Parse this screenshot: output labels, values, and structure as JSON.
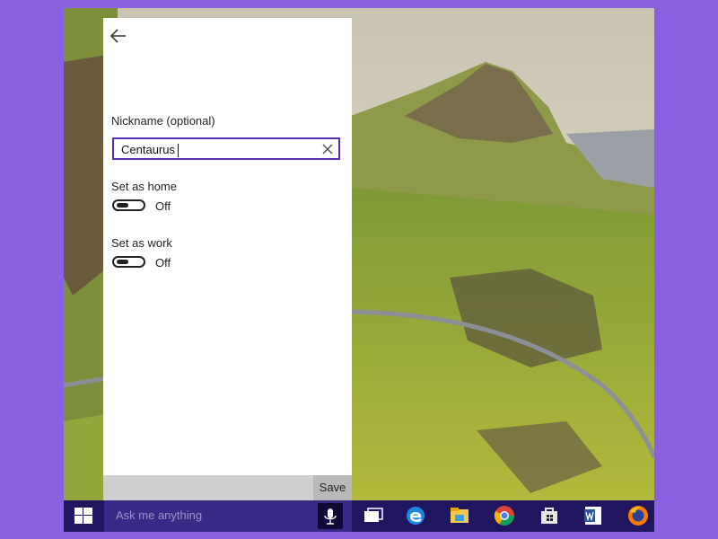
{
  "panel": {
    "nickname_label": "Nickname (optional)",
    "nickname_value": "Centaurus",
    "home_label": "Set as home",
    "home_state": "Off",
    "work_label": "Set as work",
    "work_state": "Off",
    "save_label": "Save"
  },
  "taskbar": {
    "search_placeholder": "Ask me anything",
    "icons": [
      "windows-icon",
      "microphone-icon",
      "task-view-icon",
      "edge-icon",
      "file-explorer-icon",
      "chrome-icon",
      "store-icon",
      "word-icon",
      "firefox-icon"
    ]
  },
  "colors": {
    "border_purple": "#8a5fe0",
    "accent": "#5b2db3",
    "taskbar": "#20155f",
    "search_box": "#3a2a87"
  }
}
